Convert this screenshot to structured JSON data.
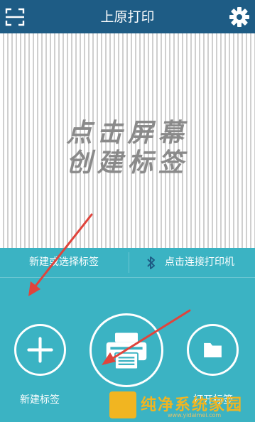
{
  "header": {
    "title": "上原打印",
    "scan_icon": "scan-icon",
    "settings_icon": "gear-icon",
    "bar_color": "#1e5c85"
  },
  "canvas": {
    "hint_line1": "点击屏幕",
    "hint_line2": "创建标签"
  },
  "panel": {
    "color": "#3bb3c3",
    "new_or_select_label": "新建或选择标签",
    "connect_printer_label": "点击连接打印机",
    "bluetooth_icon": "bluetooth-icon",
    "actions": [
      {
        "label": "新建标签",
        "icon": "plus-icon"
      },
      {
        "label": "打印",
        "icon": "printer-icon"
      },
      {
        "label": "打开标签",
        "icon": "folder-icon"
      }
    ]
  },
  "annotations": {
    "arrow_color": "#e0443c"
  },
  "watermark": {
    "text": "纯净系统家园",
    "url": "www.yidaimei.com",
    "color": "#f1b521"
  }
}
